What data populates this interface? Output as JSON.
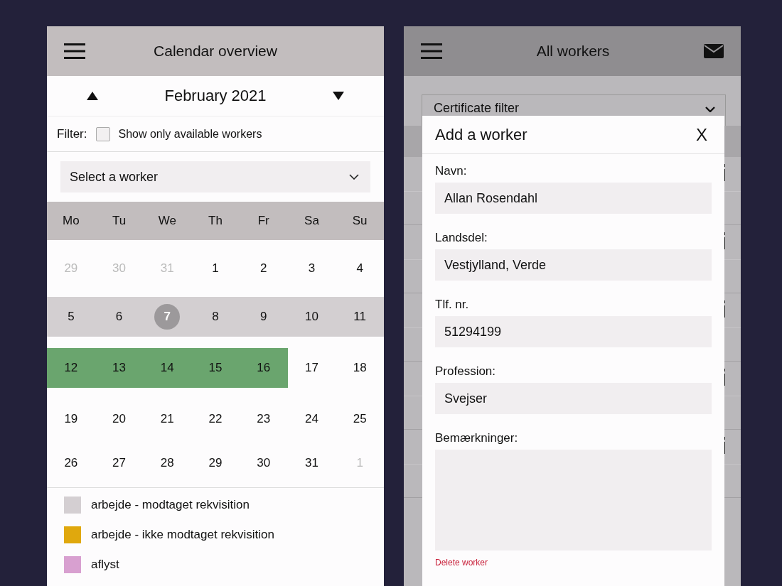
{
  "calendar_screen": {
    "title": "Calendar overview",
    "month": "February 2021",
    "filter": {
      "label": "Filter:",
      "option": "Show only available workers",
      "checked": false
    },
    "worker_select": {
      "placeholder": "Select a worker"
    },
    "weekdays": [
      "Mo",
      "Tu",
      "We",
      "Th",
      "Fr",
      "Sa",
      "Su"
    ],
    "weeks": [
      {
        "selected": false,
        "days": [
          {
            "label": "29",
            "other_month": true,
            "today": false
          },
          {
            "label": "30",
            "other_month": true,
            "today": false
          },
          {
            "label": "31",
            "other_month": true,
            "today": false
          },
          {
            "label": "1",
            "other_month": false,
            "today": false
          },
          {
            "label": "2",
            "other_month": false,
            "today": false
          },
          {
            "label": "3",
            "other_month": false,
            "today": false
          },
          {
            "label": "4",
            "other_month": false,
            "today": false
          }
        ]
      },
      {
        "selected": true,
        "days": [
          {
            "label": "5",
            "other_month": false,
            "today": false
          },
          {
            "label": "6",
            "other_month": false,
            "today": false
          },
          {
            "label": "7",
            "other_month": false,
            "today": true
          },
          {
            "label": "8",
            "other_month": false,
            "today": false
          },
          {
            "label": "9",
            "other_month": false,
            "today": false
          },
          {
            "label": "10",
            "other_month": false,
            "today": false
          },
          {
            "label": "11",
            "other_month": false,
            "today": false
          }
        ]
      },
      {
        "selected": false,
        "days": [
          {
            "label": "12",
            "other_month": false,
            "today": false,
            "color": "#6aa56e"
          },
          {
            "label": "13",
            "other_month": false,
            "today": false,
            "color": "#6aa56e"
          },
          {
            "label": "14",
            "other_month": false,
            "today": false,
            "color": "#6aa56e"
          },
          {
            "label": "15",
            "other_month": false,
            "today": false,
            "color": "#6aa56e"
          },
          {
            "label": "16",
            "other_month": false,
            "today": false,
            "color": "#6aa56e"
          },
          {
            "label": "17",
            "other_month": false,
            "today": false
          },
          {
            "label": "18",
            "other_month": false,
            "today": false
          }
        ]
      },
      {
        "selected": false,
        "days": [
          {
            "label": "19",
            "other_month": false,
            "today": false
          },
          {
            "label": "20",
            "other_month": false,
            "today": false
          },
          {
            "label": "21",
            "other_month": false,
            "today": false
          },
          {
            "label": "22",
            "other_month": false,
            "today": false
          },
          {
            "label": "23",
            "other_month": false,
            "today": false
          },
          {
            "label": "24",
            "other_month": false,
            "today": false
          },
          {
            "label": "25",
            "other_month": false,
            "today": false
          }
        ]
      },
      {
        "selected": false,
        "days": [
          {
            "label": "26",
            "other_month": false,
            "today": false
          },
          {
            "label": "27",
            "other_month": false,
            "today": false
          },
          {
            "label": "28",
            "other_month": false,
            "today": false
          },
          {
            "label": "29",
            "other_month": false,
            "today": false
          },
          {
            "label": "30",
            "other_month": false,
            "today": false
          },
          {
            "label": "31",
            "other_month": false,
            "today": false
          },
          {
            "label": "1",
            "other_month": true,
            "today": false
          }
        ]
      }
    ],
    "legend": [
      {
        "label": "arbejde - modtaget rekvisition",
        "color": "#d4cfd2"
      },
      {
        "label": "arbejde - ikke modtaget rekvisition",
        "color": "#e0a80d"
      },
      {
        "label": "aflyst",
        "color": "#d8a0d0"
      }
    ]
  },
  "workers_screen": {
    "title": "All workers",
    "certificate_filter": {
      "placeholder": "Certificate filter"
    },
    "dialog": {
      "title": "Add a worker",
      "close": "X",
      "fields": [
        {
          "label": "Navn:",
          "value": "Allan Rosendahl",
          "kind": "input"
        },
        {
          "label": "Landsdel:",
          "value": "Vestjylland, Verde",
          "kind": "input"
        },
        {
          "label": "Tlf. nr.",
          "value": "51294199",
          "kind": "input"
        },
        {
          "label": "Profession:",
          "value": "Svejser",
          "kind": "input"
        },
        {
          "label": "Bemærkninger:",
          "kind": "textarea"
        }
      ],
      "delete_link": "Delete worker"
    }
  }
}
